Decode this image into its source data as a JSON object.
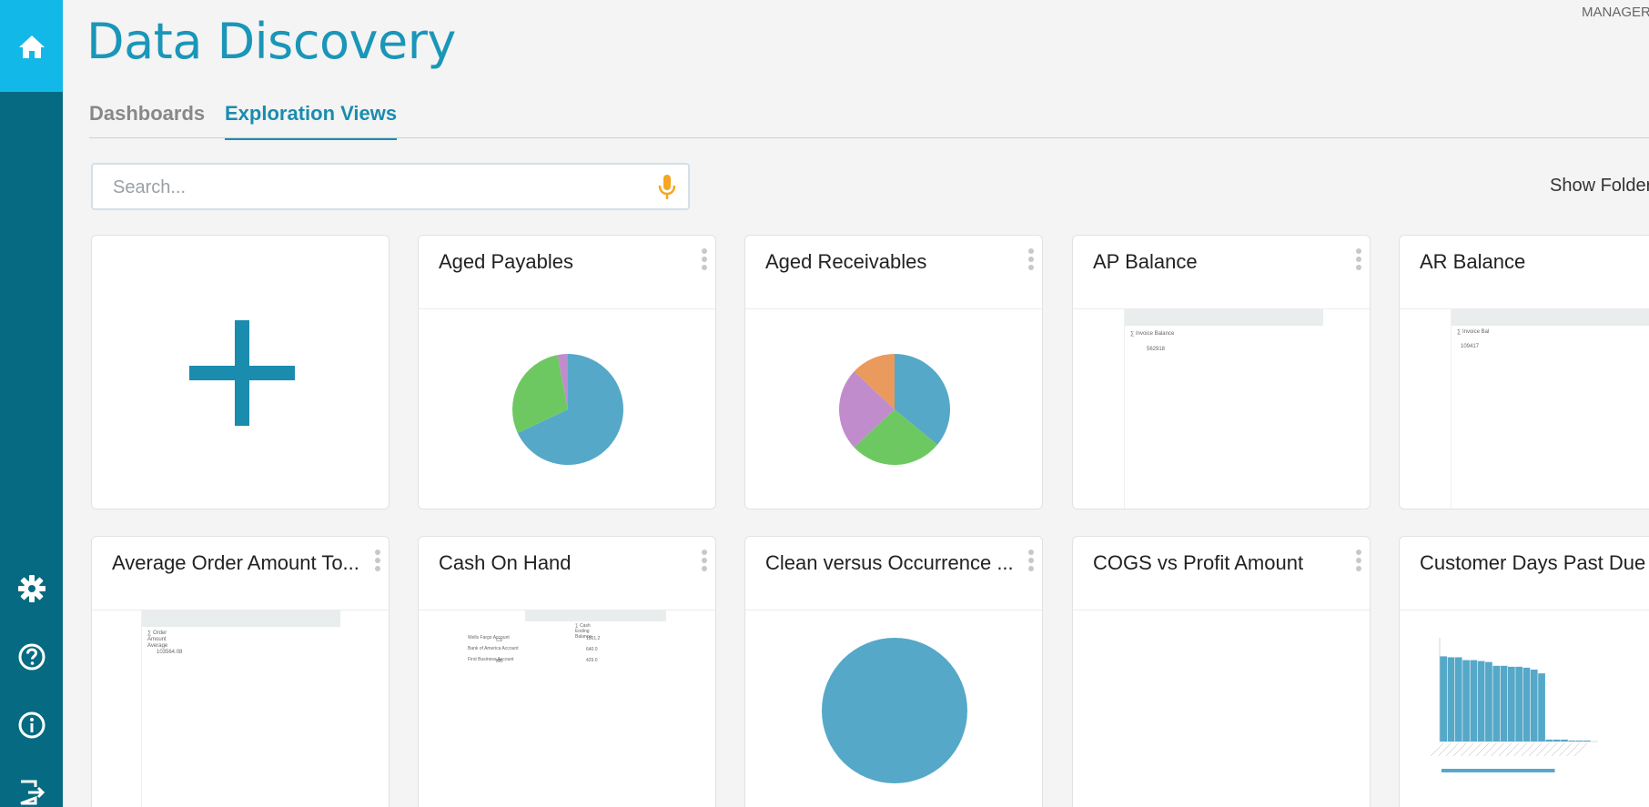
{
  "app": {
    "title": "Data Discovery",
    "user_role": "MANAGER",
    "accent_color": "#1a96b8",
    "sidebar_color": "#066b82",
    "home_tile_color": "#12b8e8"
  },
  "sidebar": {
    "items": [
      {
        "icon": "home-icon"
      },
      {
        "icon": "gear-icon"
      },
      {
        "icon": "help-icon"
      },
      {
        "icon": "info-icon"
      },
      {
        "icon": "logout-icon"
      }
    ]
  },
  "tabs": [
    {
      "label": "Dashboards",
      "active": false
    },
    {
      "label": "Exploration Views",
      "active": true
    }
  ],
  "search": {
    "placeholder": "Search...",
    "value": "",
    "icon": "microphone-icon",
    "icon_color": "#f5a623"
  },
  "toolbar": {
    "show_folders_label": "Show Folders"
  },
  "cards": [
    {
      "title": "",
      "preview": "add"
    },
    {
      "title": "Aged Payables",
      "preview": "pie"
    },
    {
      "title": "Aged Receivables",
      "preview": "pie"
    },
    {
      "title": "AP Balance",
      "preview": "table"
    },
    {
      "title": "AR Balance",
      "preview": "table"
    },
    {
      "title": "Average Order Amount To...",
      "preview": "table"
    },
    {
      "title": "Cash On Hand",
      "preview": "table"
    },
    {
      "title": "Clean versus Occurrence ...",
      "preview": "pie"
    },
    {
      "title": "COGS vs Profit Amount",
      "preview": "empty"
    },
    {
      "title": "Customer Days Past Due",
      "preview": "bar"
    }
  ],
  "chart_data": [
    {
      "type": "pie",
      "title": "Aged Payables",
      "series": [
        {
          "values": [
            68,
            29,
            3
          ]
        }
      ],
      "colors": [
        "#55a8c8",
        "#6ec862",
        "#c18ccc"
      ]
    },
    {
      "type": "pie",
      "title": "Aged Receivables",
      "series": [
        {
          "values": [
            36,
            27,
            24,
            13
          ]
        }
      ],
      "colors": [
        "#55a8c8",
        "#6ec862",
        "#c18ccc",
        "#e99a5c"
      ]
    },
    {
      "type": "pie",
      "title": "Clean versus Occurrence ...",
      "series": [
        {
          "values": [
            100
          ]
        }
      ],
      "colors": [
        "#55a8c8"
      ]
    },
    {
      "type": "bar",
      "title": "Customer Days Past Due",
      "categories": [
        "c1",
        "c2",
        "c3",
        "c4",
        "c5",
        "c6",
        "c7",
        "c8",
        "c9",
        "c10",
        "c11",
        "c12",
        "c13",
        "c14",
        "c15",
        "c16",
        "c17",
        "c18",
        "c19",
        "c20"
      ],
      "values": [
        90,
        89,
        89,
        86,
        86,
        85,
        84,
        80,
        80,
        79,
        79,
        78,
        76,
        72,
        2,
        2,
        2,
        1,
        1,
        1
      ],
      "colors": [
        "#55a8c8"
      ]
    }
  ],
  "table_previews": {
    "ap_balance": {
      "header": "∑ Invoice Balance",
      "value": "562918"
    },
    "ar_balance": {
      "header": "∑ Invoice Bal",
      "value": "109417"
    },
    "avg_order": {
      "header": "∑ Order Amount Average",
      "value": "103564.08"
    },
    "cash_on_hand": {
      "header": "∑ Cash Ending Balance",
      "rows": [
        {
          "label": "Wells Fargo Account",
          "code": "CD",
          "value": "1861.2"
        },
        {
          "label": "Bank of America Account",
          "code": "",
          "value": "640.0"
        },
        {
          "label": "First Business Account",
          "code": "MB",
          "value": "429.0"
        }
      ]
    }
  }
}
